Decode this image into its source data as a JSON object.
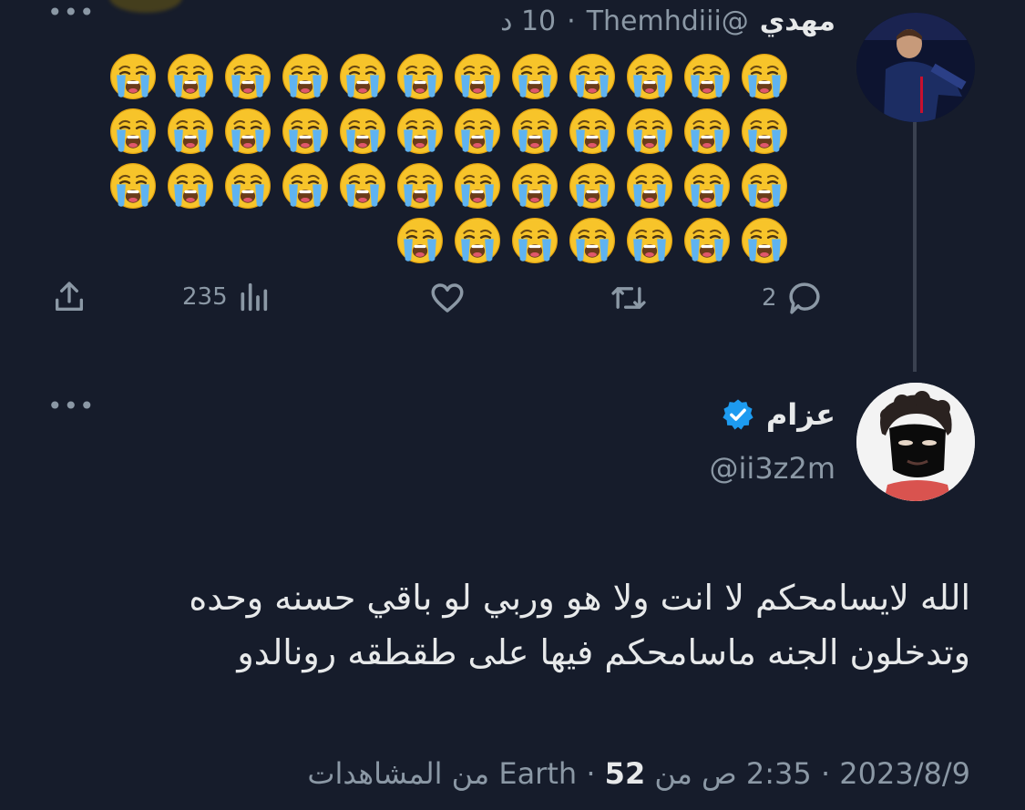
{
  "top_tweet": {
    "display_name": "مهدي",
    "handle": "@Themhdiii",
    "time": "10 د",
    "separator": "·",
    "more_label": "•••",
    "emoji_count": 43,
    "emoji_name": "loudly-crying-face",
    "actions": {
      "views_count": "235",
      "reply_count": "2"
    }
  },
  "reply_tweet": {
    "display_name": "عزام",
    "verified": true,
    "handle": "@ii3z2m",
    "more_label": "•••",
    "text_line_1": "الله لايسامحكم لا انت ولا هو وربي لو باقي حسنه وحده",
    "text_line_2": "وتدخلون الجنه ماسامحكم فيها على طقطقه رونالدو",
    "meta": {
      "date": "2023/8/9",
      "time": "2:35 ص",
      "source": "من Earth",
      "views_count": "52",
      "views_label": "من المشاهدات",
      "separator": "·"
    }
  },
  "colors": {
    "background": "#161c2b",
    "text_primary": "#e7e9ea",
    "text_muted": "#8b98a5",
    "verified_blue": "#1d9bf0",
    "thread_line": "#3a4150"
  }
}
